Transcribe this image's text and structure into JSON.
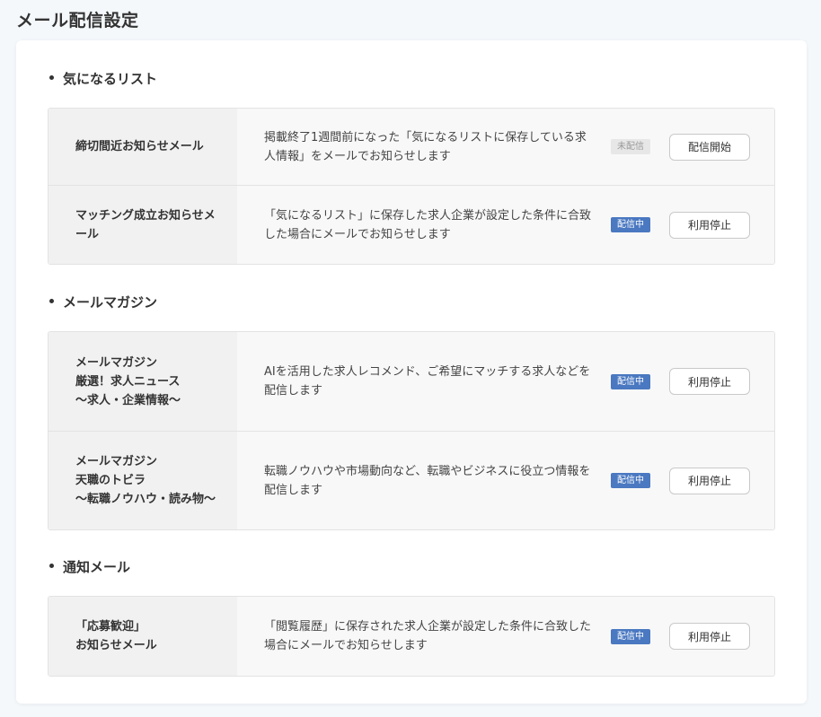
{
  "page_title": "メール配信設定",
  "sections": [
    {
      "heading": "気になるリスト",
      "rows": [
        {
          "name": "締切間近お知らせメール",
          "description": "掲載終了1週間前になった「気になるリストに保存している求人情報」をメールでお知らせします",
          "status": "未配信",
          "action": "配信開始"
        },
        {
          "name": "マッチング成立お知らせメ\nール",
          "description": "「気になるリスト」に保存した求人企業が設定した条件に合致した場合にメールでお知らせします",
          "status": "配信中",
          "action": "利用停止"
        }
      ]
    },
    {
      "heading": "メールマガジン",
      "rows": [
        {
          "name": "メールマガジン\n厳選！求人ニュース\n〜求人・企業情報〜",
          "description": "AIを活用した求人レコメンド、ご希望にマッチする求人などを配信します",
          "status": "配信中",
          "action": "利用停止"
        },
        {
          "name": "メールマガジン\n天職のトビラ\n〜転職ノウハウ・読み物〜",
          "description": "転職ノウハウや市場動向など、転職やビジネスに役立つ情報を配信します",
          "status": "配信中",
          "action": "利用停止"
        }
      ]
    },
    {
      "heading": "通知メール",
      "rows": [
        {
          "name": "「応募歓迎」\nお知らせメール",
          "description": "「閲覧履歴」に保存された求人企業が設定した条件に合致した場合にメールでお知らせします",
          "status": "配信中",
          "action": "利用停止"
        }
      ]
    }
  ],
  "colors": {
    "badge_active": "#4a78c1",
    "badge_inactive": "#e7e7e7",
    "background": "#f4f8fb"
  }
}
